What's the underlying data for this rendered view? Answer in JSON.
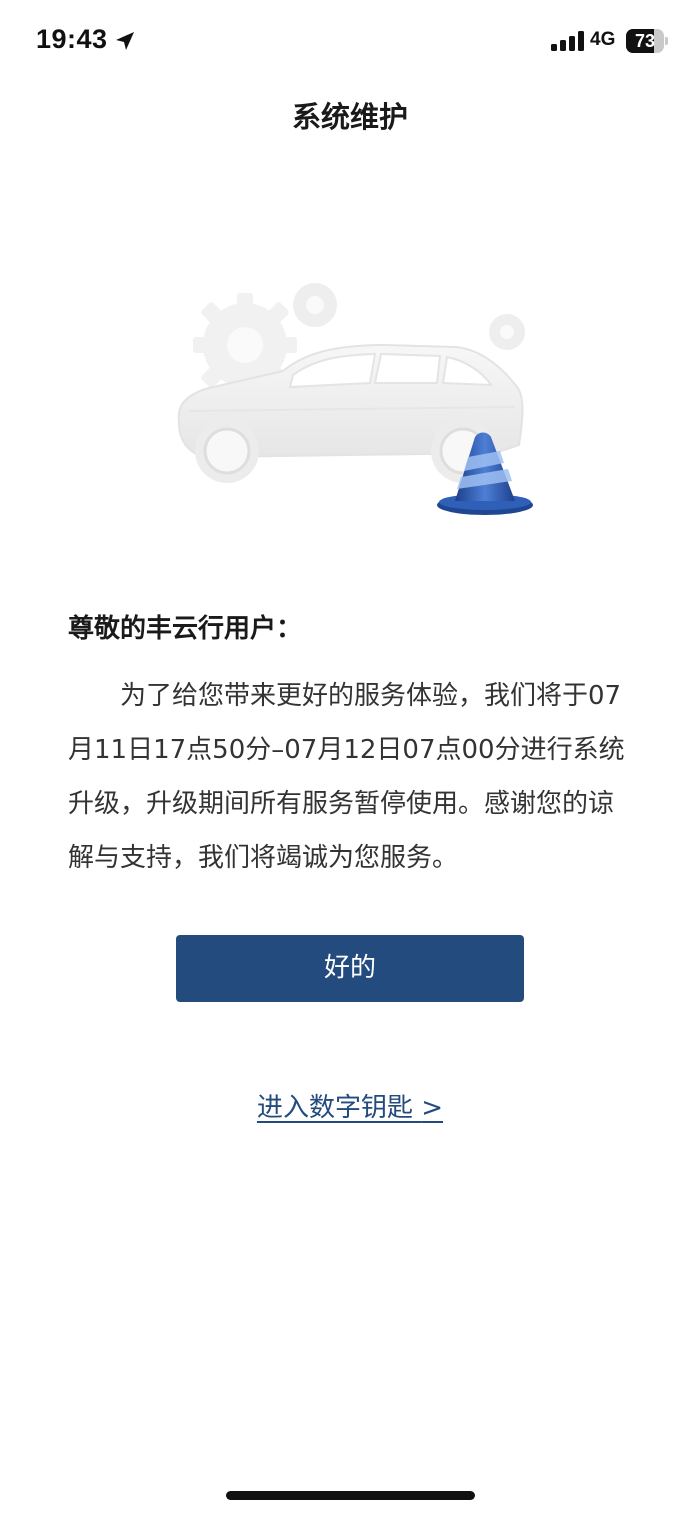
{
  "status_bar": {
    "time": "19:43",
    "network": "4G",
    "battery_percent": 73,
    "battery_label": "73",
    "icons": [
      "location-arrow-icon",
      "cellular-signal-icon",
      "battery-icon"
    ]
  },
  "header": {
    "title": "系统维护"
  },
  "illustration": {
    "icons": [
      "car-icon",
      "gear-icon",
      "traffic-cone-icon"
    ]
  },
  "notice": {
    "greeting": "尊敬的丰云行用户：",
    "body": "为了给您带来更好的服务体验，我们将于07月11日17点50分–07月12日07点00分进行系统升级，升级期间所有服务暂停使用。感谢您的谅解与支持，我们将竭诚为您服务。"
  },
  "actions": {
    "ok_label": "好的",
    "digital_key_label": "进入数字钥匙",
    "digital_key_chevron": ">"
  },
  "colors": {
    "primary": "#234b7d",
    "text": "#333333",
    "cone_blue": "#2f5fb8"
  }
}
